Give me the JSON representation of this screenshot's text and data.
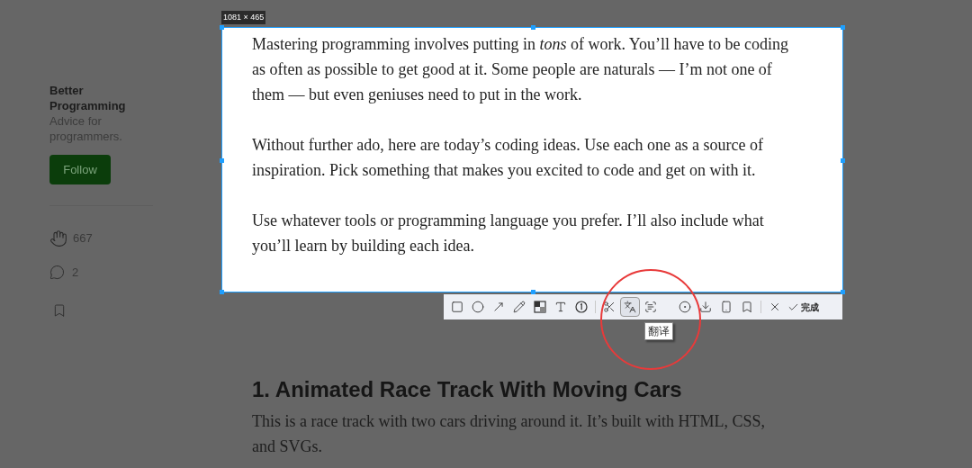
{
  "sidebar": {
    "publication": "Better Programming",
    "tagline": "Advice for programmers.",
    "follow_button": "Follow",
    "claps": "667",
    "responses": "2"
  },
  "selection": {
    "size_label": "1081 × 465",
    "paragraphs": [
      "Mastering programming involves putting in *tons* of work. You’ll have to be coding as often as possible to get good at it. Some people are naturals — I’m not one of them — but even geniuses need to put in the work.",
      "Without further ado, here are today’s coding ideas. Use each one as a source of inspiration. Pick something that makes you excited to code and get on with it.",
      "Use whatever tools or programming language you prefer. I’ll also include what you’ll learn by building each idea."
    ]
  },
  "article": {
    "heading": "1. Animated Race Track With Moving Cars",
    "body": "This is a race track with two cars driving around it. It’s built with HTML, CSS, and SVGs."
  },
  "toolbar": {
    "tools": [
      {
        "kind": "rectangle",
        "selected": false
      },
      {
        "kind": "ellipse",
        "selected": false
      },
      {
        "kind": "arrow",
        "selected": false
      },
      {
        "kind": "pencil",
        "selected": false
      },
      {
        "kind": "mosaic",
        "selected": false
      },
      {
        "kind": "text",
        "selected": false
      },
      {
        "kind": "number",
        "selected": false
      },
      {
        "kind": "divider"
      },
      {
        "kind": "cut",
        "selected": false
      },
      {
        "kind": "translate",
        "selected": true
      },
      {
        "kind": "ocr",
        "selected": false
      },
      {
        "kind": "gap"
      },
      {
        "kind": "record",
        "selected": false
      },
      {
        "kind": "download",
        "selected": false
      },
      {
        "kind": "phone",
        "selected": false
      },
      {
        "kind": "bookmark",
        "selected": false
      },
      {
        "kind": "divider"
      },
      {
        "kind": "cancel",
        "selected": false
      }
    ],
    "done": "完成",
    "tooltip": "翻译"
  }
}
